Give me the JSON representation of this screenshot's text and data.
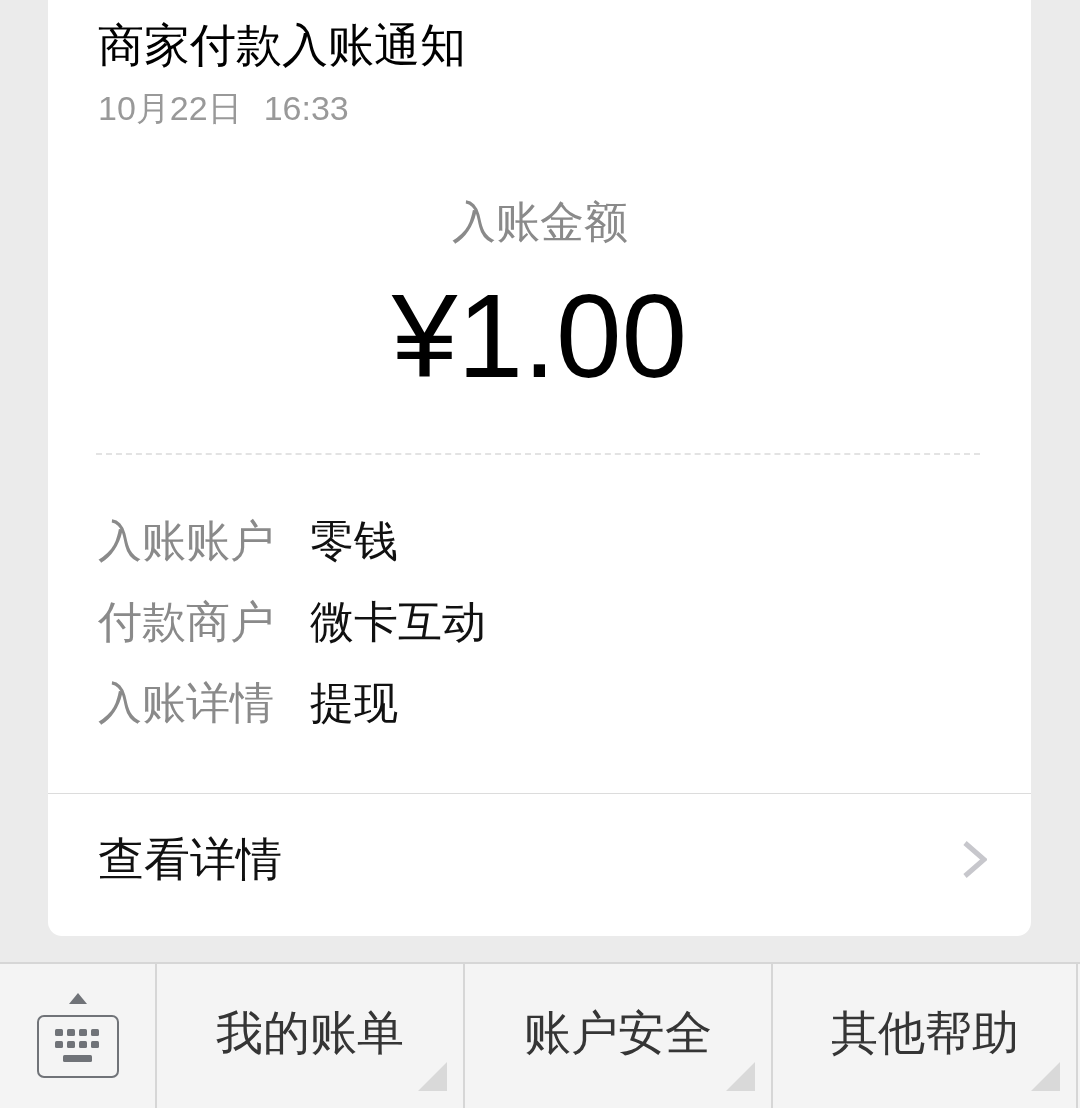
{
  "notification": {
    "title": "商家付款入账通知",
    "date": "10月22日",
    "time": "16:33",
    "amount_label": "入账金额",
    "amount": "¥1.00",
    "fields": [
      {
        "label": "入账账户",
        "value": "零钱"
      },
      {
        "label": "付款商户",
        "value": "微卡互动"
      },
      {
        "label": "入账详情",
        "value": "提现"
      }
    ],
    "link": "查看详情"
  },
  "menu": {
    "items": [
      {
        "label": "我的账单",
        "submenu": true
      },
      {
        "label": "账户安全",
        "submenu": true
      },
      {
        "label": "其他帮助",
        "submenu": true
      }
    ]
  }
}
